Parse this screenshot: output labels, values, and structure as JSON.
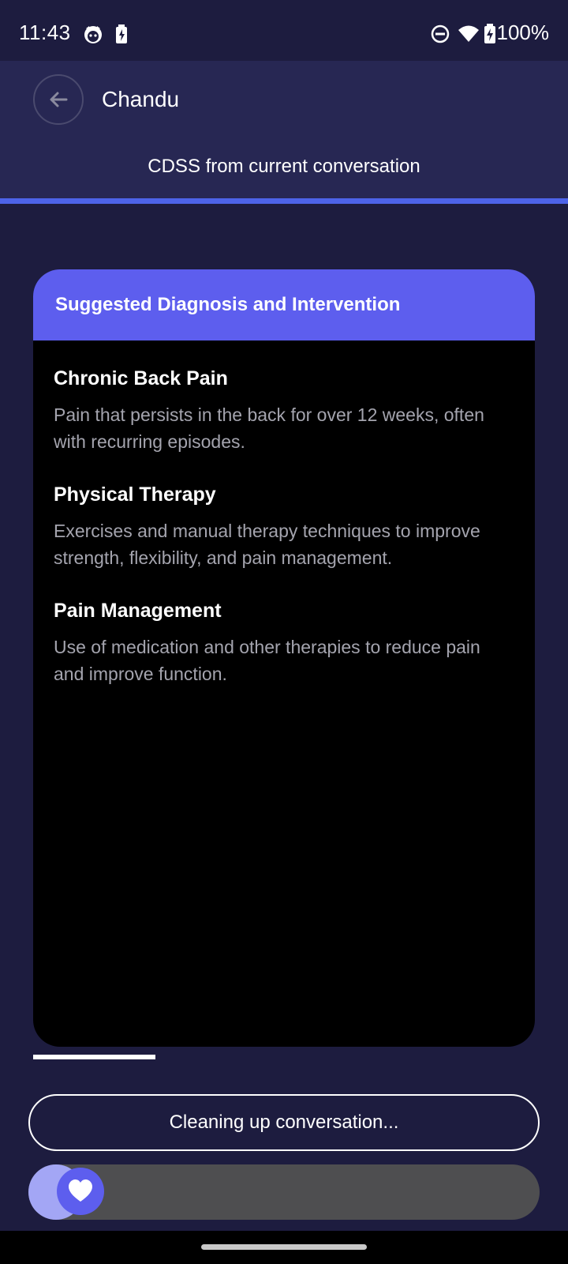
{
  "status_bar": {
    "time": "11:43",
    "battery_text": "100%",
    "icons": [
      "cat-icon",
      "battery-saver-icon",
      "do-not-disturb-icon",
      "wifi-icon",
      "battery-charging-icon"
    ]
  },
  "header": {
    "title": "Chandu",
    "back_icon": "arrow-left-icon"
  },
  "tab": {
    "label": "CDSS from current conversation"
  },
  "card": {
    "header": "Suggested Diagnosis and Intervention",
    "items": [
      {
        "title": "Chronic Back Pain",
        "description": "Pain that persists in the back for over 12 weeks, often with recurring episodes."
      },
      {
        "title": "Physical Therapy",
        "description": "Exercises and manual therapy techniques to improve strength, flexibility, and pain management."
      },
      {
        "title": "Pain Management",
        "description": "Use of medication and other therapies to reduce pain and improve function."
      }
    ]
  },
  "actions": {
    "cleaning_label": "Cleaning up conversation..."
  },
  "slider": {
    "icon": "heart-icon",
    "progress": 0
  },
  "colors": {
    "background": "#1d1c3f",
    "header": "#272753",
    "accent": "#5d5eee",
    "tab_indicator": "#4d63e8",
    "card": "#000000"
  }
}
